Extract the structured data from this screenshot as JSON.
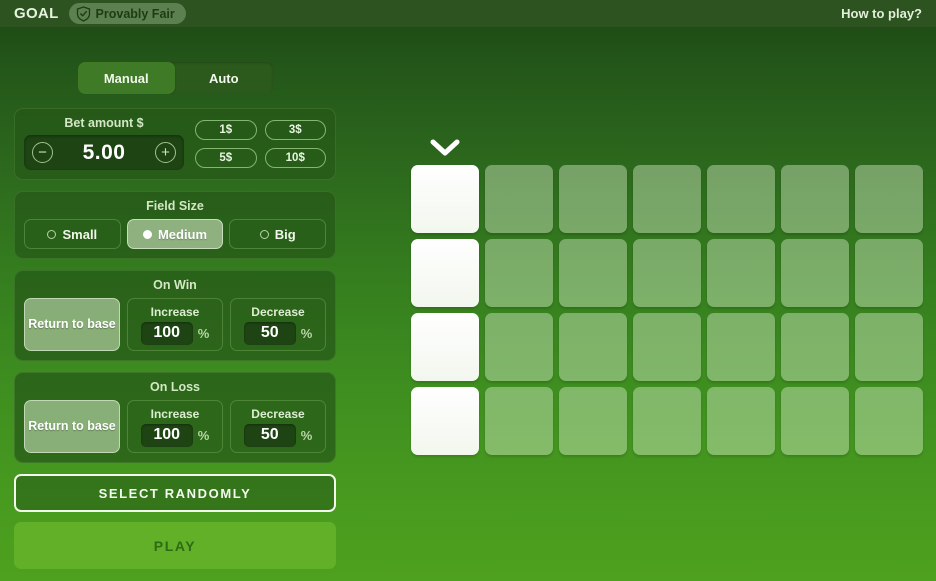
{
  "header": {
    "game_title": "GOAL",
    "provably_fair": "Provably Fair",
    "shield_icon": "shield-check-icon",
    "how_to_play": "How to play?"
  },
  "mode_tabs": {
    "items": [
      {
        "label": "Manual",
        "active": true
      },
      {
        "label": "Auto",
        "active": false
      }
    ]
  },
  "bet": {
    "title": "Bet amount $",
    "value": "5.00",
    "decrement_icon": "minus-circle-icon",
    "decrement_label": "−",
    "increment_icon": "plus-circle-icon",
    "increment_label": "+",
    "quick_bets": [
      "1$",
      "3$",
      "5$",
      "10$"
    ]
  },
  "field_size": {
    "title": "Field Size",
    "options": [
      {
        "label": "Small",
        "selected": false
      },
      {
        "label": "Medium",
        "selected": true
      },
      {
        "label": "Big",
        "selected": false
      }
    ]
  },
  "on_win": {
    "title": "On Win",
    "return_to_base": "Return to base",
    "return_to_base_active": true,
    "increase_label": "Increase",
    "increase_value": "100",
    "increase_unit": "%",
    "decrease_label": "Decrease",
    "decrease_value": "50",
    "decrease_unit": "%"
  },
  "on_loss": {
    "title": "On Loss",
    "return_to_base": "Return to base",
    "return_to_base_active": true,
    "increase_label": "Increase",
    "increase_value": "100",
    "increase_unit": "%",
    "decrease_label": "Decrease",
    "decrease_value": "50",
    "decrease_unit": "%"
  },
  "actions": {
    "select_randomly": "SELECT RANDOMLY",
    "play": "PLAY"
  },
  "board": {
    "columns": 7,
    "rows": 4,
    "pointer_icon": "chevron-down-icon",
    "pointer_column": 1,
    "revealed_column": 1
  },
  "colors": {
    "background_top": "#1d4713",
    "background_bottom": "#4ea11e",
    "header_bar": "#2c5320",
    "play_button": "#61b028",
    "play_text": "#2f6b16",
    "cell_idle": "rgba(222,240,208,0.42)",
    "cell_revealed": "#ffffff",
    "accent_light": "#cde4be"
  }
}
